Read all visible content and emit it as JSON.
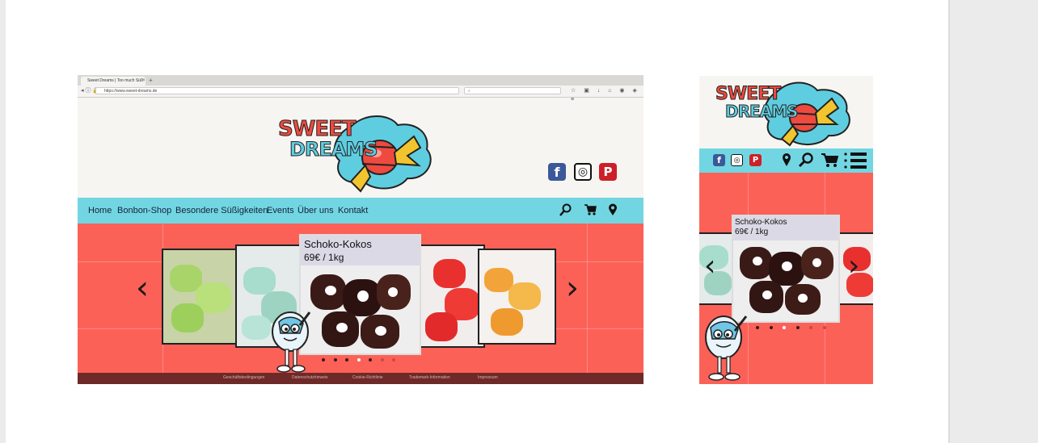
{
  "desktop": {
    "browser": {
      "tab_title": "Sweet Dreams | Too much Süß",
      "tab_close": "×",
      "new_tab": "+",
      "nav_buttons": "◂ ⓘ 🔒",
      "url": "https://www.sweet-dreams.de",
      "search_placeholder": "⌕",
      "toolbar_icons": "☆ ▣ ↓ ⌂ ◉ ◈ ≡"
    },
    "logo": {
      "line1": "SWEET",
      "line2": "DREAMS"
    },
    "social": {
      "facebook": "f",
      "instagram": "◎",
      "pinterest": "P"
    },
    "nav": [
      "Home",
      "Bonbon-Shop",
      "Besondere Süßigkeiten",
      "Events",
      "Über uns",
      "Kontakt"
    ],
    "nav_icons": {
      "search": "⚲",
      "cart": "🛒",
      "location": "⚲"
    },
    "carousel": {
      "caption_title": "Schoko-Kokos",
      "caption_price": "69€ / 1kg",
      "prev": "‹",
      "next": "›",
      "dots": 7,
      "active_dot": 3
    },
    "footer": [
      "Geschäftsbedingungen",
      "Datenschutzhinweis",
      "Cookie-Richtlinie",
      "Trademark-Information",
      "Impressum"
    ]
  },
  "mobile": {
    "logo": {
      "line1": "SWEET",
      "line2": "DREAMS"
    },
    "social": {
      "facebook": "f",
      "instagram": "◎",
      "pinterest": "P"
    },
    "icons": {
      "location": "location-icon",
      "search": "search-icon",
      "cart": "cart-icon",
      "menu": "menu-icon"
    },
    "carousel": {
      "caption_title": "Schoko-Kokos",
      "caption_price": "69€ / 1kg",
      "prev": "‹",
      "next": "›",
      "dots": 6,
      "active_dot": 2
    }
  },
  "colors": {
    "nav_bar": "#72d6e2",
    "stage": "#fc6158",
    "footer": "#6e2a28",
    "logo_red": "#ee4a3f",
    "logo_blue": "#5fcde0",
    "facebook": "#3b5998",
    "pinterest": "#cb2027"
  }
}
